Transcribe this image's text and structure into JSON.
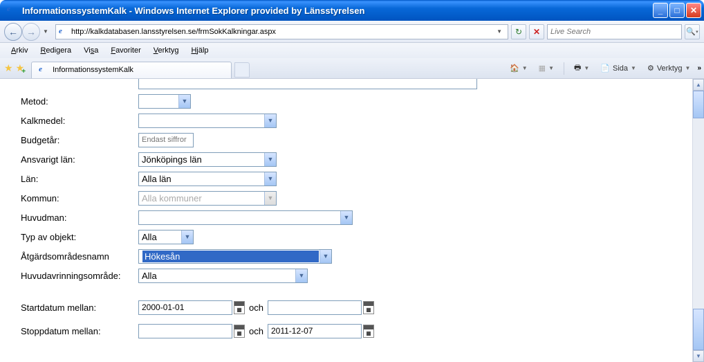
{
  "window": {
    "title": "InformationssystemKalk - Windows Internet Explorer provided by Länsstyrelsen"
  },
  "nav": {
    "url": "http://kalkdatabasen.lansstyrelsen.se/frmSokKalkningar.aspx",
    "search_placeholder": "Live Search"
  },
  "menu": {
    "arkiv": "Arkiv",
    "redigera": "Redigera",
    "visa": "Visa",
    "favoriter": "Favoriter",
    "verktyg": "Verktyg",
    "hjalp": "Hjälp"
  },
  "tab": {
    "title": "InformationssystemKalk"
  },
  "toolbar": {
    "sida": "Sida",
    "verktyg": "Verktyg"
  },
  "form": {
    "metod": {
      "label": "Metod:",
      "value": ""
    },
    "kalkmedel": {
      "label": "Kalkmedel:",
      "value": ""
    },
    "budgetar": {
      "label": "Budgetår:",
      "placeholder": "Endast siffror"
    },
    "ansvarigt_lan": {
      "label": "Ansvarigt län:",
      "value": "Jönköpings län"
    },
    "lan": {
      "label": "Län:",
      "value": "Alla län"
    },
    "kommun": {
      "label": "Kommun:",
      "value": "Alla kommuner"
    },
    "huvudman": {
      "label": "Huvudman:",
      "value": ""
    },
    "typ_av_objekt": {
      "label": "Typ av objekt:",
      "value": "Alla"
    },
    "atgardsomradesnamn": {
      "label": "Åtgärdsområdesnamn",
      "value": "Hökesån"
    },
    "huvudavrinningsomrade": {
      "label": "Huvudavrinningsområde:",
      "value": "Alla"
    },
    "startdatum": {
      "label": "Startdatum mellan:",
      "from": "2000-01-01",
      "to": "",
      "och": "och"
    },
    "stoppdatum": {
      "label": "Stoppdatum mellan:",
      "from": "",
      "to": "2011-12-07",
      "och": "och"
    }
  }
}
